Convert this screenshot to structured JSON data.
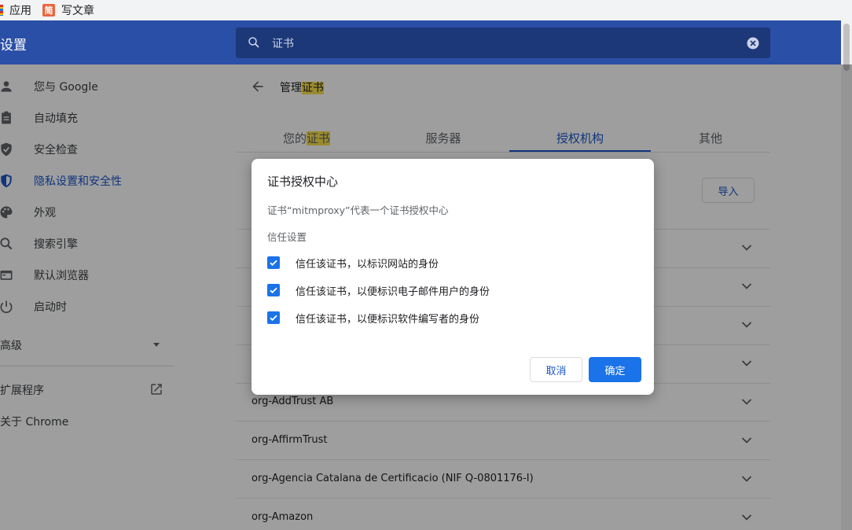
{
  "bookmarks": {
    "apps_label": "应用",
    "jian_icon_text": "简",
    "write_label": "写文章"
  },
  "header": {
    "title": "设置",
    "search_value": "证书"
  },
  "sidebar": {
    "items": [
      {
        "label": "您与 Google",
        "icon": "person-icon"
      },
      {
        "label": "自动填充",
        "icon": "clipboard-icon"
      },
      {
        "label": "安全检查",
        "icon": "shield-check-icon"
      },
      {
        "label": "隐私设置和安全性",
        "icon": "privacy-shield-icon"
      },
      {
        "label": "外观",
        "icon": "palette-icon"
      },
      {
        "label": "搜索引擎",
        "icon": "search-icon"
      },
      {
        "label": "默认浏览器",
        "icon": "browser-icon"
      },
      {
        "label": "启动时",
        "icon": "power-icon"
      }
    ],
    "advanced_label": "高级",
    "extensions_label": "扩展程序",
    "about_label": "关于 Chrome"
  },
  "main": {
    "title_prefix": "管理",
    "title_highlight": "证书",
    "tabs": [
      {
        "label_prefix": "您的",
        "label_highlight": "证书"
      },
      {
        "label": "服务器"
      },
      {
        "label": "授权机构"
      },
      {
        "label": "其他"
      }
    ],
    "import_label": "导入",
    "rows": [
      "org-AddTrust AB",
      "org-AffirmTrust",
      "org-Agencia Catalana de Certificacio (NIF Q-0801176-I)",
      "org-Amazon"
    ]
  },
  "dialog": {
    "title": "证书授权中心",
    "description": "证书“mitmproxy”代表一个证书授权中心",
    "section_label": "信任设置",
    "checkboxes": [
      {
        "label": "信任该证书，以标识网站的身份",
        "checked": true
      },
      {
        "label": "信任该证书，以便标识电子邮件用户的身份",
        "checked": true
      },
      {
        "label": "信任该证书，以便标识软件编写者的身份",
        "checked": true
      }
    ],
    "cancel_label": "取消",
    "ok_label": "确定"
  },
  "colors": {
    "header_bg": "#2a4fa6",
    "accent": "#1a73e8",
    "highlight": "#f8e04b"
  }
}
